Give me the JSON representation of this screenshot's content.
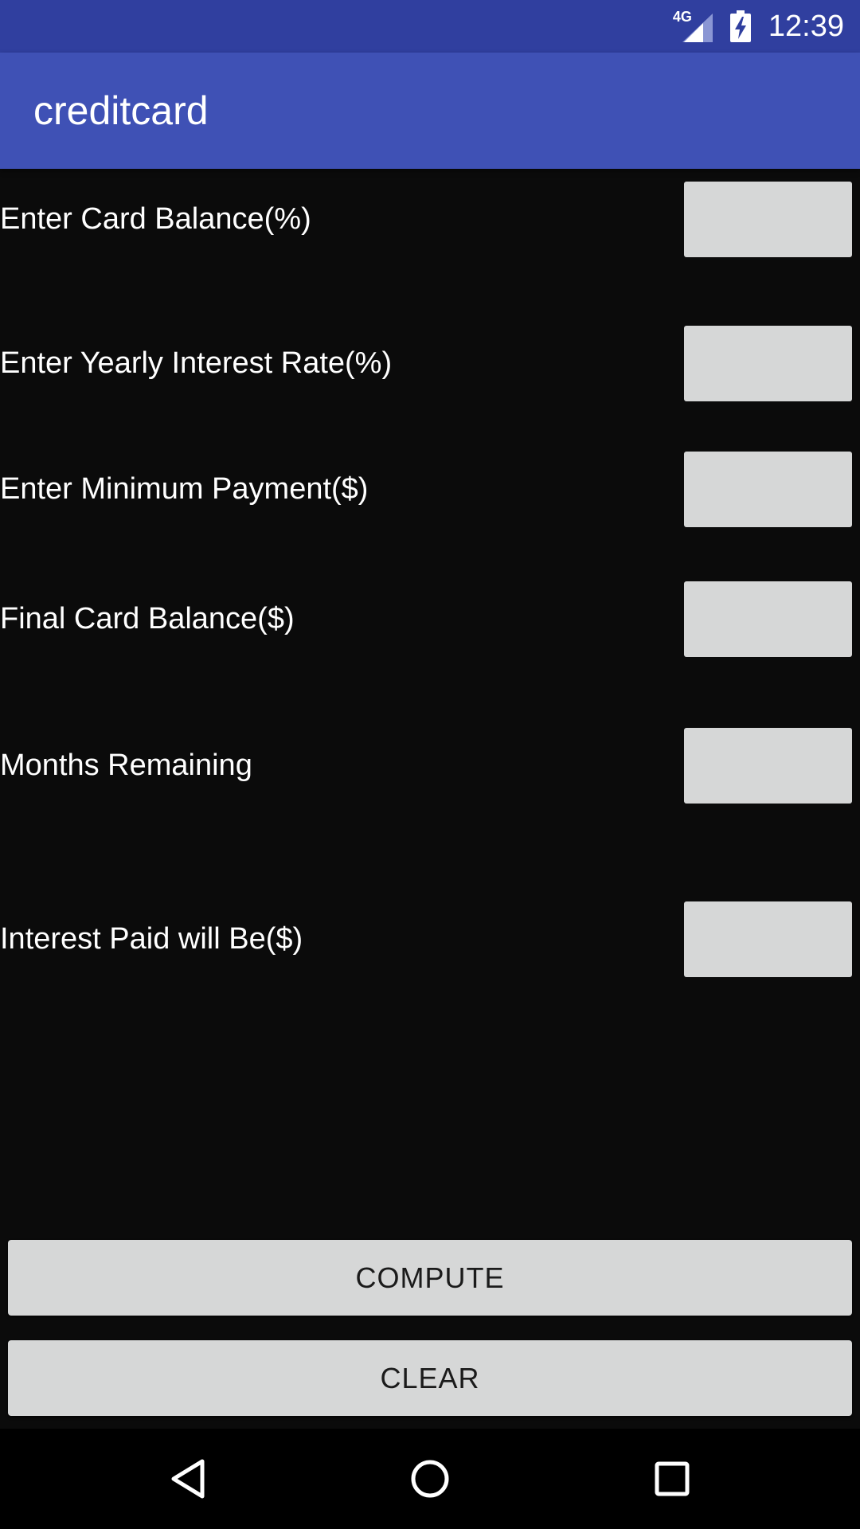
{
  "status_bar": {
    "network_label": "4G",
    "time": "12:39",
    "icons": [
      "signal-icon",
      "battery-charging-icon"
    ]
  },
  "app_bar": {
    "title": "creditcard"
  },
  "form": {
    "rows": [
      {
        "label": "Enter Card Balance(%)",
        "value": ""
      },
      {
        "label": "Enter Yearly Interest Rate(%)",
        "value": ""
      },
      {
        "label": "Enter Minimum Payment($)",
        "value": ""
      },
      {
        "label": "Final Card Balance($)",
        "value": ""
      },
      {
        "label": "Months Remaining",
        "value": ""
      },
      {
        "label": "Interest Paid will Be($)",
        "value": ""
      }
    ]
  },
  "buttons": {
    "compute_label": "COMPUTE",
    "clear_label": "CLEAR"
  },
  "nav_bar": {
    "icons": [
      "back-icon",
      "home-icon",
      "recents-icon"
    ]
  },
  "colors": {
    "status_bar": "#303f9f",
    "app_bar": "#3f51b5",
    "background": "#0b0b0b",
    "field": "#d6d7d7"
  }
}
